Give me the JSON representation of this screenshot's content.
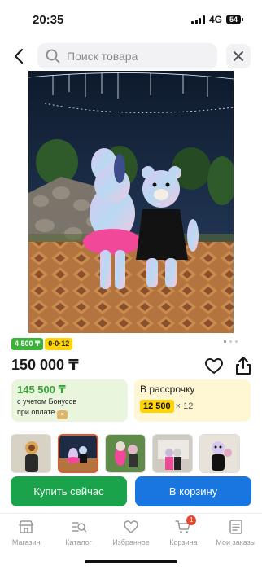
{
  "status": {
    "time": "20:35",
    "network": "4G",
    "battery": "54"
  },
  "search": {
    "placeholder": "Поиск товара"
  },
  "product": {
    "image_alt": "Ростовые куклы зайчик и мишка",
    "badge_discount": "4 500 ₸",
    "badge_installment": "0·0·12",
    "price": "150 000 ₸",
    "bonus_price": "145 500 ₸",
    "bonus_line1": "с учетом Бонусов",
    "bonus_line2": "при оплате",
    "installment_title": "В рассрочку",
    "installment_amount": "12 500",
    "installment_multiplier": "× 12"
  },
  "thumbnails": [
    {
      "name": "thumbnail-1",
      "scene": "bear-sunflower"
    },
    {
      "name": "thumbnail-2",
      "scene": "night-duo",
      "active": true
    },
    {
      "name": "thumbnail-3",
      "scene": "garden-duo"
    },
    {
      "name": "thumbnail-4",
      "scene": "indoor-duo"
    },
    {
      "name": "thumbnail-5",
      "scene": "bear-light"
    }
  ],
  "actions": {
    "buy_now": "Купить сейчас",
    "add_to_cart": "В корзину"
  },
  "tabs": [
    {
      "label": "Магазин",
      "icon": "shop-icon"
    },
    {
      "label": "Каталог",
      "icon": "catalog-icon"
    },
    {
      "label": "Избранное",
      "icon": "heart-icon"
    },
    {
      "label": "Корзина",
      "icon": "cart-icon",
      "badge": "1"
    },
    {
      "label": "Мои заказы",
      "icon": "orders-icon"
    }
  ],
  "colors": {
    "green": "#1aa34a",
    "blue": "#1976e0",
    "yellow": "#ffd400",
    "badge_red": "#e8452c"
  }
}
